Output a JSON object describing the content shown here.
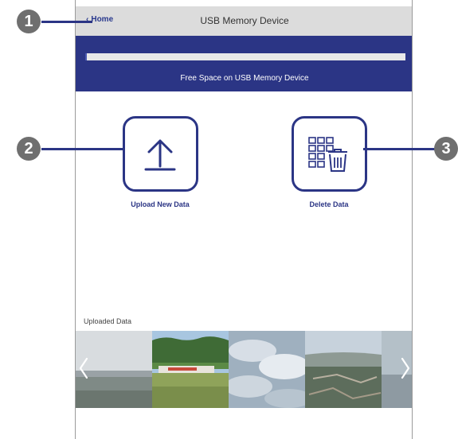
{
  "topbar": {
    "home_label": "Home",
    "title": "USB Memory Device"
  },
  "storage": {
    "label": "Free Space on USB Memory Device",
    "used_fraction": 0.005
  },
  "actions": {
    "upload_label": "Upload New Data",
    "delete_label": "Delete Data"
  },
  "uploaded": {
    "title": "Uploaded Data"
  },
  "callouts": [
    "1",
    "2",
    "3"
  ],
  "colors": {
    "accent": "#2b3585",
    "topbar": "#dcdcdc",
    "callout": "#6f6f6f"
  },
  "icons": {
    "home": "chevron-left-icon",
    "upload": "upload-arrow-icon",
    "delete": "grid-trash-icon",
    "prev": "chevron-left-icon",
    "next": "chevron-right-icon"
  }
}
